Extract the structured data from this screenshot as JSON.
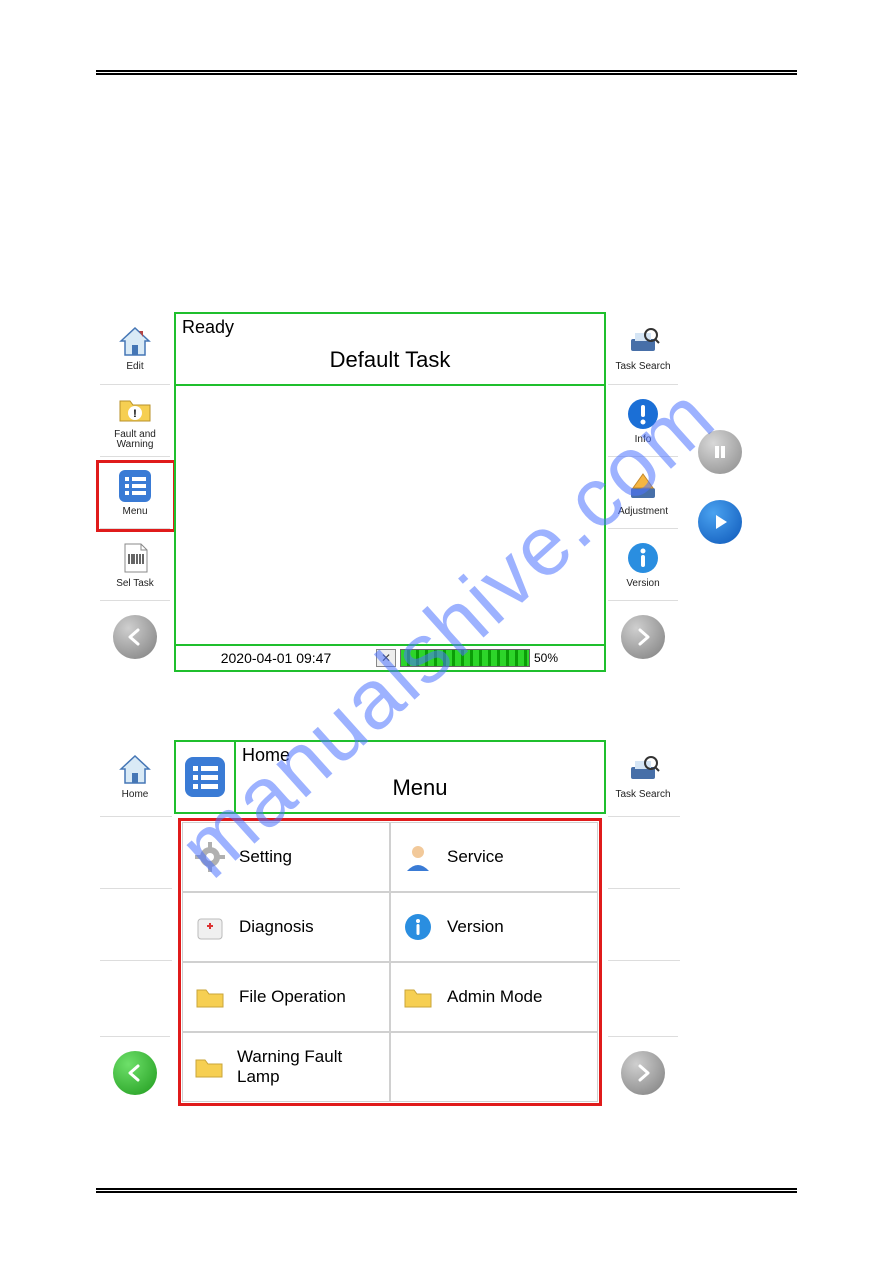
{
  "watermark": "manualshive.com",
  "screenshot1": {
    "status": "Ready",
    "title": "Default Task",
    "datetime": "2020-04-01 09:47",
    "progress_pct": "50%",
    "left_buttons": [
      {
        "label": "Edit"
      },
      {
        "label": "Fault and Warning"
      },
      {
        "label": "Menu"
      },
      {
        "label": "Sel Task"
      }
    ],
    "right_buttons": [
      {
        "label": "Task Search"
      },
      {
        "label": "Info"
      },
      {
        "label": "Adjustment"
      },
      {
        "label": "Version"
      }
    ]
  },
  "screenshot2": {
    "breadcrumb": "Home",
    "title": "Menu",
    "left_buttons": [
      {
        "label": "Home"
      }
    ],
    "right_buttons": [
      {
        "label": "Task Search"
      }
    ],
    "menu_items": [
      {
        "label": "Setting"
      },
      {
        "label": "Service"
      },
      {
        "label": "Diagnosis"
      },
      {
        "label": "Version"
      },
      {
        "label": "File Operation"
      },
      {
        "label": "Admin Mode"
      },
      {
        "label": "Warning Fault Lamp"
      }
    ]
  }
}
